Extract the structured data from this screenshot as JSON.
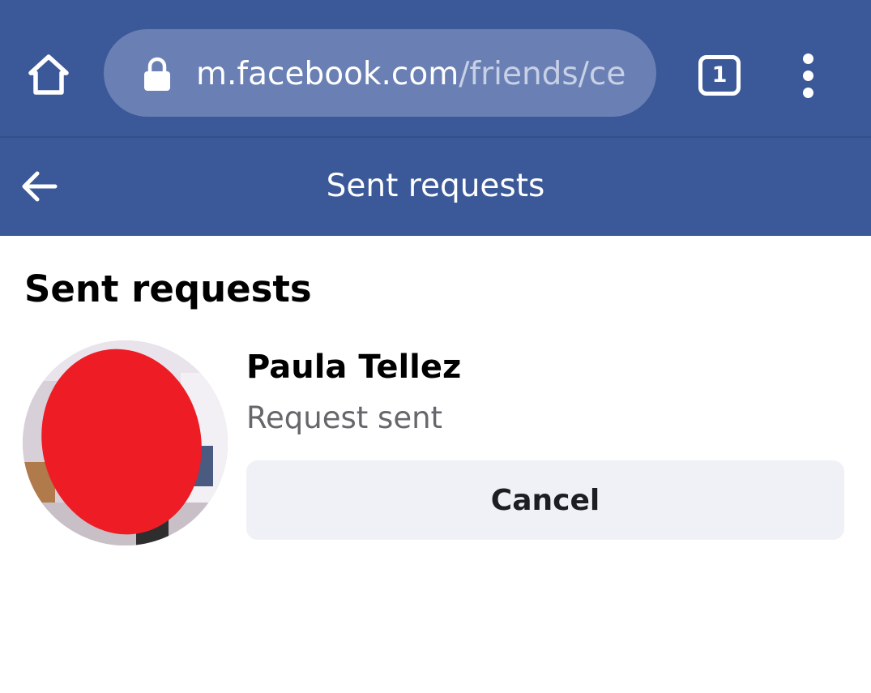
{
  "browser": {
    "url_host": "m.facebook.com",
    "url_path": "/friends/ce",
    "tab_count": "1",
    "icons": {
      "home": "home-icon",
      "lock": "lock-icon",
      "menu": "more-vert-icon"
    }
  },
  "header": {
    "title": "Sent requests",
    "back_icon": "arrow-left-icon"
  },
  "main": {
    "section_title": "Sent requests",
    "requests": [
      {
        "name": "Paula Tellez",
        "status": "Request sent",
        "action_label": "Cancel"
      }
    ]
  },
  "colors": {
    "brand_blue": "#3b5998",
    "url_pill": "#6a80b4",
    "button_bg": "#f0f1f6",
    "status_text": "#65676b",
    "avatar_redaction": "#ee1c25"
  }
}
